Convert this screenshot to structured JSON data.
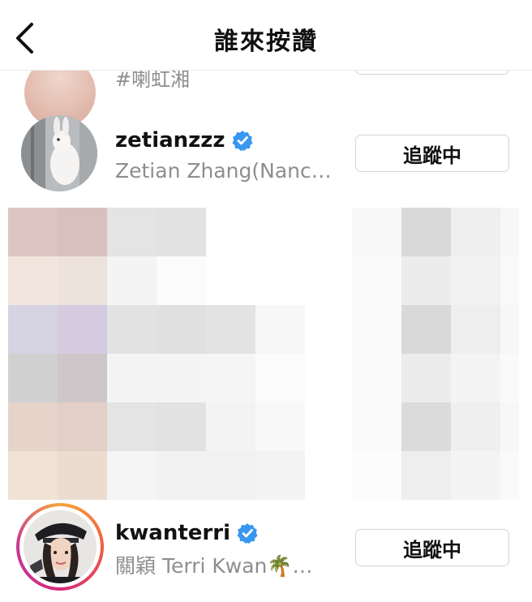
{
  "header": {
    "title": "誰來按讚",
    "back_icon": "chevron-left-icon"
  },
  "partial_row": {
    "fullname_partial": "#喇虹湘"
  },
  "rows": [
    {
      "username": "zetianzzz",
      "verified": true,
      "fullname": "Zetian Zhang(Nanc…",
      "button_label": "追蹤中"
    },
    {
      "username": "kwanterri",
      "verified": true,
      "fullname": "關穎 Terri Kwan🌴…",
      "button_label": "追蹤中"
    }
  ],
  "colors": {
    "verified_blue": "#3897f0",
    "secondary_text": "#8e8e8e",
    "border": "#d4d4d4"
  }
}
